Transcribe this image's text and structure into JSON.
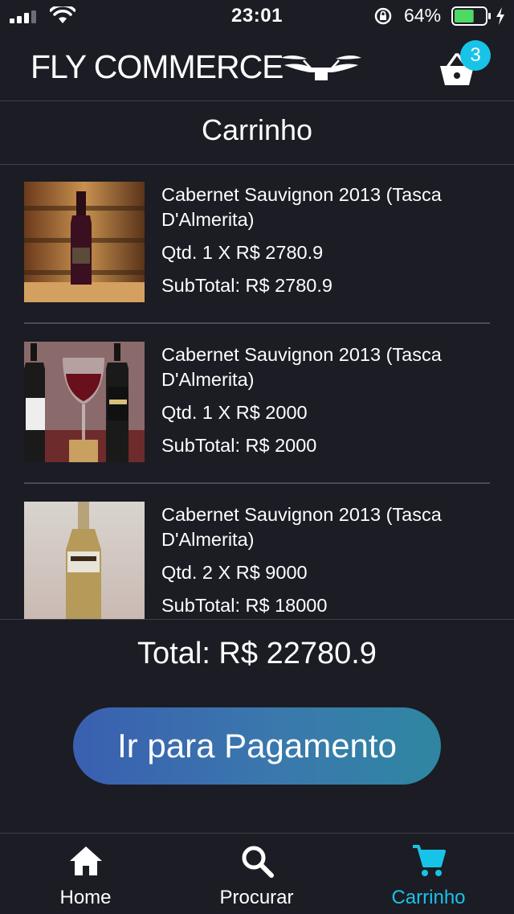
{
  "status_bar": {
    "time": "23:01",
    "battery_pct": "64%",
    "battery_level": 0.64
  },
  "header": {
    "logo_text": "FLY COMMERCE",
    "cart_count": "3"
  },
  "page": {
    "title": "Carrinho"
  },
  "cart_items": [
    {
      "name": "Cabernet Sauvignon 2013 (Tasca D'Almerita)",
      "qty_line": "Qtd. 1 X R$ 2780.9",
      "subtotal_line": "SubTotal: R$ 2780.9"
    },
    {
      "name": "Cabernet Sauvignon 2013 (Tasca D'Almerita)",
      "qty_line": "Qtd. 1 X R$ 2000",
      "subtotal_line": "SubTotal: R$ 2000"
    },
    {
      "name": "Cabernet Sauvignon 2013 (Tasca D'Almerita)",
      "qty_line": "Qtd. 2 X R$ 9000",
      "subtotal_line": "SubTotal: R$ 18000"
    }
  ],
  "summary": {
    "total_line": "Total: R$ 22780.9",
    "checkout_label": "Ir para Pagamento"
  },
  "tabs": [
    {
      "label": "Home",
      "icon": "home-icon",
      "active": false
    },
    {
      "label": "Procurar",
      "icon": "search-icon",
      "active": false
    },
    {
      "label": "Carrinho",
      "icon": "cart-icon",
      "active": true
    }
  ],
  "colors": {
    "background": "#1b1c24",
    "accent": "#18c3e8",
    "button_start": "#3a5fb0",
    "button_end": "#2f86a2",
    "battery": "#4cd964"
  }
}
